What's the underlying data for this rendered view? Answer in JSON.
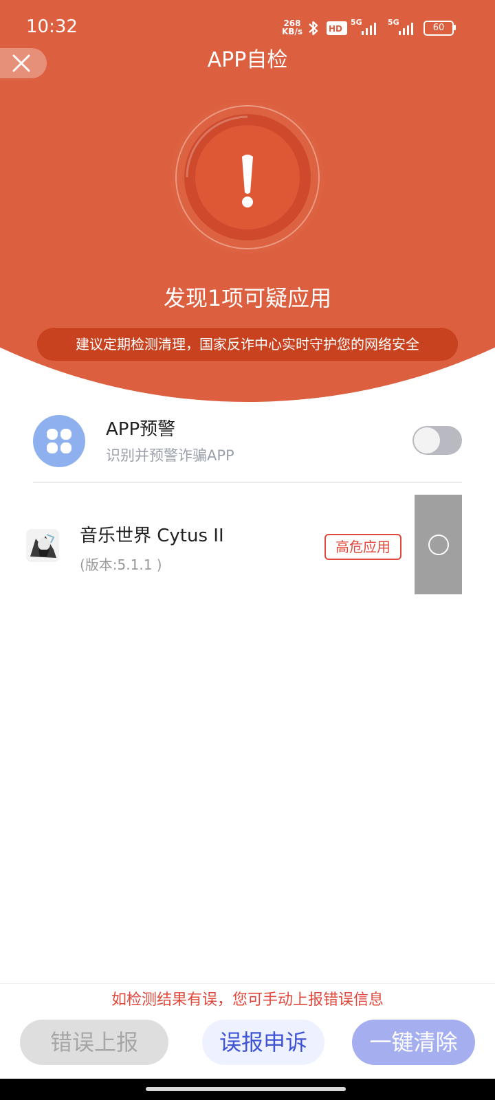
{
  "status_bar": {
    "time": "10:32",
    "net_speed_value": "268",
    "net_speed_unit": "KB/s",
    "signal_1_label": "5G",
    "signal_2_label": "5G",
    "battery": "60",
    "icons": [
      "bluetooth-icon",
      "hd-icon",
      "signal-icon",
      "battery-icon"
    ]
  },
  "header": {
    "title": "APP自检",
    "close_icon": "close-icon"
  },
  "hero": {
    "alert_icon": "exclamation-icon",
    "message": "发现1项可疑应用",
    "tip": "建议定期检测清理，国家反诈中心实时守护您的网络安全",
    "color": "#dc5f3f"
  },
  "warning_setting": {
    "icon": "app-grid-icon",
    "title": "APP预警",
    "subtitle": "识别并预警诈骗APP",
    "enabled": false
  },
  "suspicious_apps": [
    {
      "name": "音乐世界 Cytus II",
      "version": "(版本:5.1.1 )",
      "risk_label": "高危应用",
      "selected": false
    }
  ],
  "footer": {
    "note": "如检测结果有误，您可手动上报错误信息",
    "report_button": "错误上报",
    "appeal_button": "误报申诉",
    "clear_button": "一键清除"
  }
}
